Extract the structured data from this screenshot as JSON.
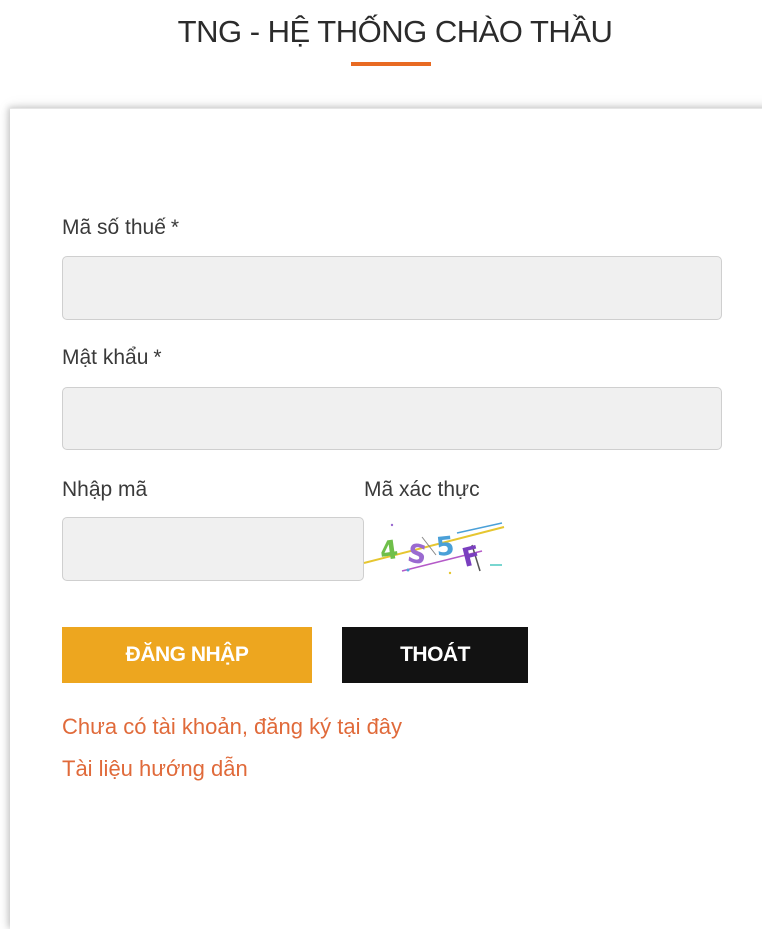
{
  "header": {
    "title": "TNG - HỆ THỐNG CHÀO THẦU"
  },
  "form": {
    "tax_code": {
      "label": "Mã số thuế",
      "required_mark": "*",
      "value": ""
    },
    "password": {
      "label": "Mật khẩu",
      "required_mark": "*",
      "value": ""
    },
    "captcha_input": {
      "label": "Nhập mã",
      "value": ""
    },
    "captcha": {
      "label": "Mã xác thực",
      "characters": [
        "4",
        "S",
        "5",
        "F"
      ]
    }
  },
  "buttons": {
    "login_label": "ĐĂNG NHẬP",
    "exit_label": "THOÁT"
  },
  "links": {
    "register": "Chưa có tài khoản, đăng ký tại đây",
    "guide": "Tài liệu hướng dẫn"
  },
  "colors": {
    "accent": "#e86a22",
    "login_button": "#eda61f",
    "exit_button": "#121212",
    "link": "#e06a3a",
    "input_background": "#f0f0f0"
  }
}
